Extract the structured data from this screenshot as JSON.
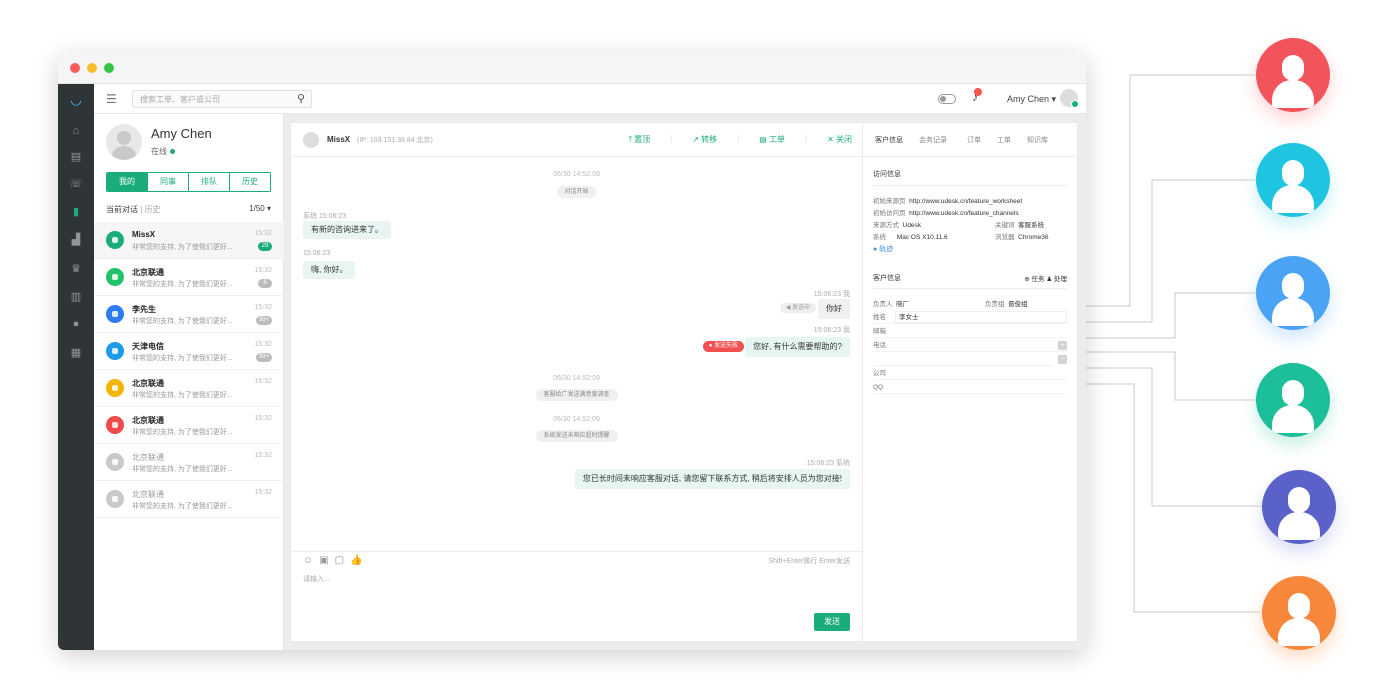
{
  "search": {
    "placeholder": "搜索工单、客户或公司"
  },
  "header": {
    "agent_name": "Amy Chen ▾"
  },
  "profile": {
    "name": "Amy Chen",
    "status": "在线"
  },
  "tabs": [
    "我的",
    "同事",
    "排队",
    "历史"
  ],
  "conv_filter": {
    "current": "当前对话",
    "divider": " | ",
    "history": "历史",
    "count": "1/50 ▾"
  },
  "conversations": [
    {
      "name": "MissX",
      "msg": "非常您的支持, 为了使我们更好...",
      "time": "15:32",
      "badge": "29",
      "badge_color": "green",
      "avatar_color": "#1aad7a",
      "selected": true
    },
    {
      "name": "北京联通",
      "msg": "非常您的支持, 为了使我们更好...",
      "time": "15:32",
      "badge": "6",
      "badge_color": "gray",
      "avatar_color": "#1fc36b",
      "selected": false
    },
    {
      "name": "李先生",
      "msg": "非常您的支持, 为了使我们更好...",
      "time": "15:32",
      "badge": "99+",
      "badge_color": "gray",
      "avatar_color": "#2d7cf2",
      "selected": false
    },
    {
      "name": "天津电信",
      "msg": "非常您的支持, 为了使我们更好...",
      "time": "15:32",
      "badge": "99+",
      "badge_color": "gray",
      "avatar_color": "#1e9be8",
      "selected": false
    },
    {
      "name": "北京联通",
      "msg": "非常您的支持, 为了使我们更好...",
      "time": "15:32",
      "badge": "",
      "badge_color": "",
      "avatar_color": "#f5b400",
      "selected": false
    },
    {
      "name": "北京联通",
      "msg": "非常您的支持, 为了使我们更好...",
      "time": "15:32",
      "badge": "",
      "badge_color": "",
      "avatar_color": "#ef4b4b",
      "selected": false
    },
    {
      "name": "北京联通",
      "msg": "非常您的支持, 为了使我们更好...",
      "time": "15:32",
      "badge": "",
      "badge_color": "",
      "avatar_color": "#c9c9c9",
      "selected": false,
      "gray": true
    },
    {
      "name": "北京联通",
      "msg": "非常您的支持, 为了使我们更好...",
      "time": "15:32",
      "badge": "",
      "badge_color": "",
      "avatar_color": "#c9c9c9",
      "selected": false,
      "gray": true
    }
  ],
  "chat": {
    "name": "MissX",
    "ip": "(IP: 103.151.38.84 北京)",
    "actions": [
      "置顶",
      "转移",
      "工单",
      "关闭"
    ],
    "messages": {
      "time1": "06/30 14:52:09",
      "start": "对话开始",
      "sys_meta": "系统 15:06:23",
      "sys_msg": "有新的咨询进来了。",
      "cust_time": "15:06:23",
      "cust_msg": "嗨, 你好。",
      "agent_meta1": "15:06:23 我",
      "sending": "◀ 发送中",
      "agent_msg1": "你好",
      "agent_meta2": "15:06:23 我",
      "failed": "● 发送失败",
      "agent_msg2": "您好, 有什么需要帮助的?",
      "time2": "06/30 14:52:09",
      "event1": "客服给广发送满意度调查",
      "time3": "06/30 14:52:09",
      "event2": "系统发送未响应超时提醒",
      "sys_meta2": "15:06:23 系统",
      "sys_msg2": "您已长时间未响应客服对话, 请您留下联系方式, 稍后将安排人员为您对接!"
    },
    "tools_hint": "Shift+Enter换行 Enter发送",
    "input_placeholder": "请输入...",
    "send": "发送"
  },
  "customer": {
    "tabs": [
      "客户信息",
      "会务记录",
      "订单",
      "工单",
      "知识库"
    ],
    "visit_title": "访问信息",
    "visit": [
      {
        "k": "初始来源页",
        "v": "http://www.udesk.cn/feature_worksheet"
      },
      {
        "k": "初始访问页",
        "v": "http://www.udesk.cn/feature_channels"
      },
      {
        "k": "来源方式",
        "v": "Udesk",
        "k2": "关键词",
        "v2": "客服系统"
      },
      {
        "k": "系统",
        "v": "Mac OS X10.11.6",
        "k2": "浏览器",
        "v2": "Chrome36"
      }
    ],
    "trail": "● 轨迹",
    "info_title": "客户信息",
    "info_actions": "⊕ 任务  ♟ 处理",
    "owner_label": "负责人",
    "owner": "晓厂",
    "group_label": "负责组",
    "group": "晋俊组",
    "fields": [
      {
        "k": "姓名",
        "v": "李女士"
      },
      {
        "k": "邮箱",
        "v": ""
      },
      {
        "k": "电话",
        "v": ""
      },
      {
        "k": "",
        "v": ""
      },
      {
        "k": "公司",
        "v": ""
      },
      {
        "k": "QQ",
        "v": ""
      }
    ]
  },
  "agents": [
    {
      "color": "#f2545b",
      "glow": "#ffd3d5"
    },
    {
      "color": "#1fc4e0",
      "glow": "#c8f1f8"
    },
    {
      "color": "#4aa3f5",
      "glow": "#cfe6fd"
    },
    {
      "color": "#1dbf9a",
      "glow": "#c6efe4"
    },
    {
      "color": "#5a62c9",
      "glow": "#d9dbf5"
    },
    {
      "color": "#f7873a",
      "glow": "#fddcc5"
    }
  ]
}
